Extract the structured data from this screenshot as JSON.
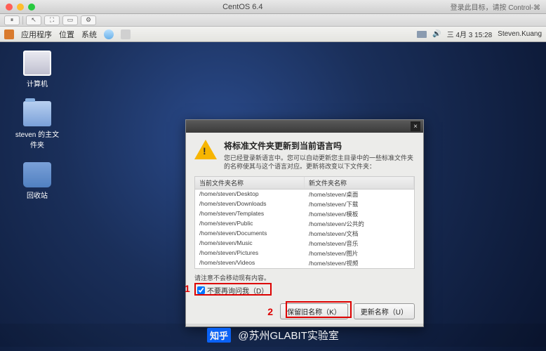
{
  "mac": {
    "title": "CentOS 6.4",
    "right_hint": "登录此目标，请按 Control-⌘"
  },
  "gnome": {
    "menus": [
      "应用程序",
      "位置",
      "系统"
    ],
    "clock": "三 4月  3 15:28",
    "user": "Steven.Kuang"
  },
  "desktop_icons": {
    "computer": "计算机",
    "home": "steven 的主文件夹",
    "trash": "回收站"
  },
  "dialog": {
    "heading": "将标准文件夹更新到当前语言吗",
    "message": "您已经登录新语言中。您可以自动更新您主目录中的一些标准文件夹的名称使其与这个语言对应。更新将改变以下文件夹：",
    "col_current": "当前文件夹名称",
    "col_new": "新文件夹名称",
    "rows": [
      {
        "cur": "/home/steven/Desktop",
        "new": "/home/steven/桌面"
      },
      {
        "cur": "/home/steven/Downloads",
        "new": "/home/steven/下载"
      },
      {
        "cur": "/home/steven/Templates",
        "new": "/home/steven/模板"
      },
      {
        "cur": "/home/steven/Public",
        "new": "/home/steven/公共的"
      },
      {
        "cur": "/home/steven/Documents",
        "new": "/home/steven/文档"
      },
      {
        "cur": "/home/steven/Music",
        "new": "/home/steven/音乐"
      },
      {
        "cur": "/home/steven/Pictures",
        "new": "/home/steven/图片"
      },
      {
        "cur": "/home/steven/Videos",
        "new": "/home/steven/视频"
      }
    ],
    "note": "请注意不会移动现有内容。",
    "dont_ask": "不要再询问我（D）",
    "btn_keep": "保留旧名称（K）",
    "btn_update": "更新名称（U）"
  },
  "annotations": {
    "one": "1",
    "two": "2"
  },
  "watermark": {
    "logo": "知乎",
    "text": "@苏州GLABIT实验室"
  }
}
